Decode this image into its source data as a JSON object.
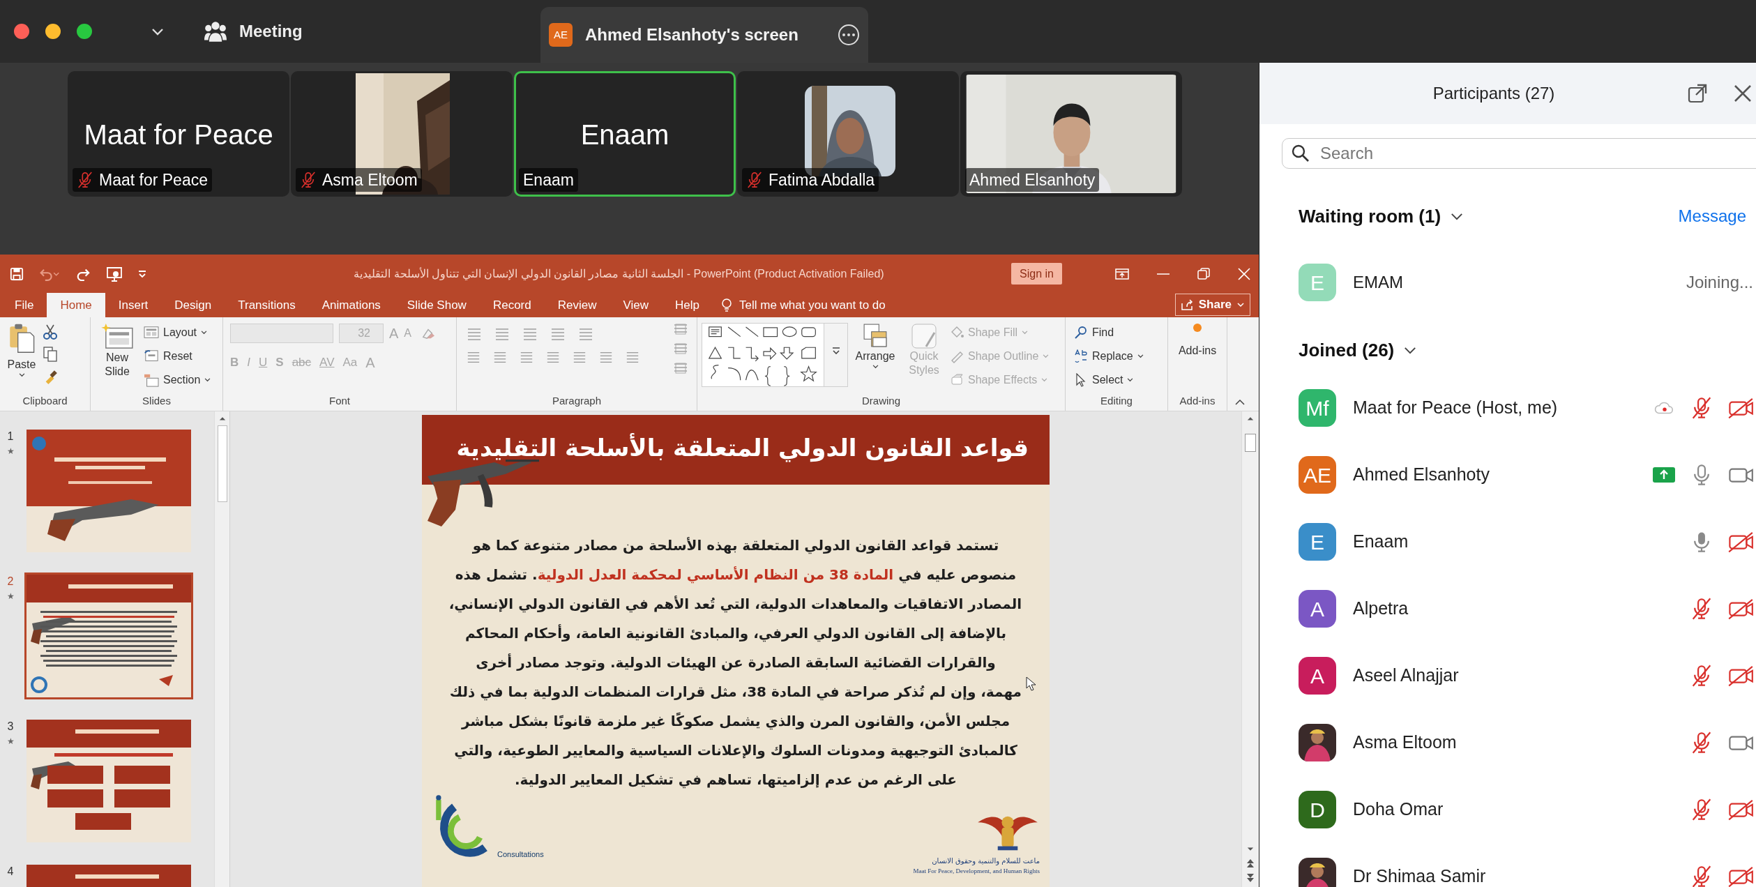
{
  "top_bar": {
    "view_menu": "Meeting",
    "share_tab": {
      "badge": "AE",
      "title": "Ahmed Elsanhoty's screen"
    }
  },
  "gallery": [
    {
      "kind": "name",
      "display_name": "Maat for Peace",
      "label": "Maat for Peace",
      "muted": true,
      "speaking": false
    },
    {
      "kind": "video",
      "label": "Asma Eltoom",
      "muted": true,
      "speaking": false
    },
    {
      "kind": "name",
      "display_name": "Enaam",
      "label": "Enaam",
      "muted": false,
      "speaking": true
    },
    {
      "label": "Fatima Abdalla",
      "muted": true,
      "speaking": false
    },
    {
      "kind": "video_full",
      "label": "Ahmed Elsanhoty",
      "muted": false,
      "speaking": false
    }
  ],
  "powerpoint": {
    "title": "الجلسة الثانية مصادر القانون الدولي الإنسان التي تتناول الأسلحة التقليدية  -  PowerPoint (Product Activation Failed)",
    "sign_in": "Sign in",
    "tabs": [
      {
        "label": "File",
        "selected": false
      },
      {
        "label": "Home",
        "selected": true
      },
      {
        "label": "Insert",
        "selected": false
      },
      {
        "label": "Design",
        "selected": false
      },
      {
        "label": "Transitions",
        "selected": false
      },
      {
        "label": "Animations",
        "selected": false
      },
      {
        "label": "Slide Show",
        "selected": false
      },
      {
        "label": "Record",
        "selected": false
      },
      {
        "label": "Review",
        "selected": false
      },
      {
        "label": "View",
        "selected": false
      },
      {
        "label": "Help",
        "selected": false
      }
    ],
    "tell_me": "Tell me what you want to do",
    "share": "Share",
    "ribbon": {
      "clipboard": {
        "paste": "Paste",
        "label": "Clipboard"
      },
      "slides": {
        "new_slide": "New Slide",
        "layout": "Layout",
        "reset": "Reset",
        "section": "Section",
        "label": "Slides"
      },
      "font": {
        "disabled": true,
        "size": "32",
        "grow": "A",
        "shrink": "A",
        "styles": [
          "B",
          "I",
          "U",
          "S",
          "abc",
          "AV",
          "Aa",
          "A"
        ],
        "label": "Font"
      },
      "paragraph": {
        "label": "Paragraph"
      },
      "drawing": {
        "arrange": "Arrange",
        "quick_styles": {
          "label": "Quick Styles",
          "disabled": true
        },
        "format_items": [
          {
            "label": "Shape Fill",
            "disabled": true
          },
          {
            "label": "Shape Outline",
            "disabled": true
          },
          {
            "label": "Shape Effects",
            "disabled": true
          }
        ],
        "label": "Drawing"
      },
      "editing": {
        "find": "Find",
        "replace": "Replace",
        "select": "Select",
        "label": "Editing"
      },
      "addins": {
        "button": "Add-ins",
        "label": "Add-ins"
      }
    },
    "thumbnails": [
      {
        "number": "1",
        "star": "★",
        "kind": "title",
        "selected": false
      },
      {
        "number": "2",
        "star": "★",
        "kind": "text",
        "selected": true
      },
      {
        "number": "3",
        "star": "★",
        "kind": "boxes",
        "selected": false
      },
      {
        "number": "4",
        "kind": "boxes",
        "selected": false
      }
    ],
    "slide": {
      "title": "قواعد القانون الدولي المتعلقة بالأسلحة التقليدية",
      "lines": [
        [
          {
            "text": "تستمد قواعد القانون الدولي المتعلقة بهذه الأسلحة من مصادر متنوعة كما هو",
            "highlight": false
          }
        ],
        [
          {
            "text": "منصوص عليه في ",
            "highlight": false
          },
          {
            "text": "المادة 38 من النظام الأساسي لمحكمة العدل الدولية",
            "highlight": true
          },
          {
            "text": ". تشمل هذه",
            "highlight": false
          }
        ],
        [
          {
            "text": "المصادر الاتفاقيات والمعاهدات الدولية، التي تُعد الأهم في القانون الدولي الإنساني،",
            "highlight": false
          }
        ],
        [
          {
            "text": "بالإضافة إلى القانون الدولي العرفي، والمبادئ القانونية العامة، وأحكام المحاكم",
            "highlight": false
          }
        ],
        [
          {
            "text": "والقرارات القضائية السابقة الصادرة عن الهيئات الدولية. وتوجد مصادر أخرى",
            "highlight": false
          }
        ],
        [
          {
            "text": "مهمة، وإن لم تُذكر صراحة في المادة 38، مثل قرارات المنظمات الدولية بما في ذلك",
            "highlight": false
          }
        ],
        [
          {
            "text": "مجلس الأمن، والقانون المرن والذي يشمل صكوكًا غير ملزمة قانونًا بشكل مباشر",
            "highlight": false
          }
        ],
        [
          {
            "text": "كالمبادئ التوجيهية ومدونات السلوك والإعلانات السياسية والمعايير الطوعية، والتي",
            "highlight": false
          }
        ],
        [
          {
            "text": "على الرغم من عدم إلزاميتها، تساهم في تشكيل المعايير الدولية.",
            "highlight": false
          }
        ]
      ],
      "left_logo_caption": "Consultations",
      "right_logo_caption_ar": "ماعت للسلام والتنمية وحقوق الانسان",
      "right_logo_caption_en": "Maat For Peace, Development, and Human Rights"
    }
  },
  "participants": {
    "title": "Participants (27)",
    "search": {
      "placeholder": "Search"
    },
    "waiting_room": {
      "heading": "Waiting room (1)",
      "action": "Message",
      "people": [
        {
          "kind": "initials",
          "initials": "E",
          "name": "EMAM",
          "color": "#93dbb8",
          "status_text": "Joining..."
        }
      ]
    },
    "joined": {
      "heading": "Joined (26)",
      "people": [
        {
          "kind": "initials",
          "initials": "Mf",
          "name": "Maat for Peace (Host, me)",
          "color": "#2fb66c",
          "recording": true,
          "sharing": false,
          "speaking": false,
          "muted": true,
          "video_on": false
        },
        {
          "kind": "initials",
          "initials": "AE",
          "name": "Ahmed Elsanhoty",
          "color": "#e0691b",
          "recording": false,
          "sharing": true,
          "speaking": false,
          "muted": false,
          "video_on": true
        },
        {
          "kind": "initials",
          "initials": "E",
          "name": "Enaam",
          "color": "#3a8ec9",
          "recording": false,
          "sharing": false,
          "speaking": true,
          "muted": false,
          "video_on": false
        },
        {
          "kind": "initials",
          "initials": "A",
          "name": "Alpetra",
          "color": "#7b57c4",
          "recording": false,
          "sharing": false,
          "speaking": false,
          "muted": true,
          "video_on": false
        },
        {
          "kind": "initials",
          "initials": "A",
          "name": "Aseel Alnajjar",
          "color": "#c81d5c",
          "recording": false,
          "sharing": false,
          "speaking": false,
          "muted": true,
          "video_on": false
        },
        {
          "name": "Asma Eltoom",
          "recording": false,
          "sharing": false,
          "speaking": false,
          "muted": true,
          "video_on": true
        },
        {
          "kind": "initials",
          "initials": "D",
          "name": "Doha Omar",
          "color": "#2e6a1c",
          "recording": false,
          "sharing": false,
          "speaking": false,
          "muted": true,
          "video_on": false
        },
        {
          "name": "Dr Shimaa Samir",
          "recording": false,
          "sharing": false,
          "speaking": false,
          "muted": true,
          "video_on": false
        }
      ]
    }
  }
}
